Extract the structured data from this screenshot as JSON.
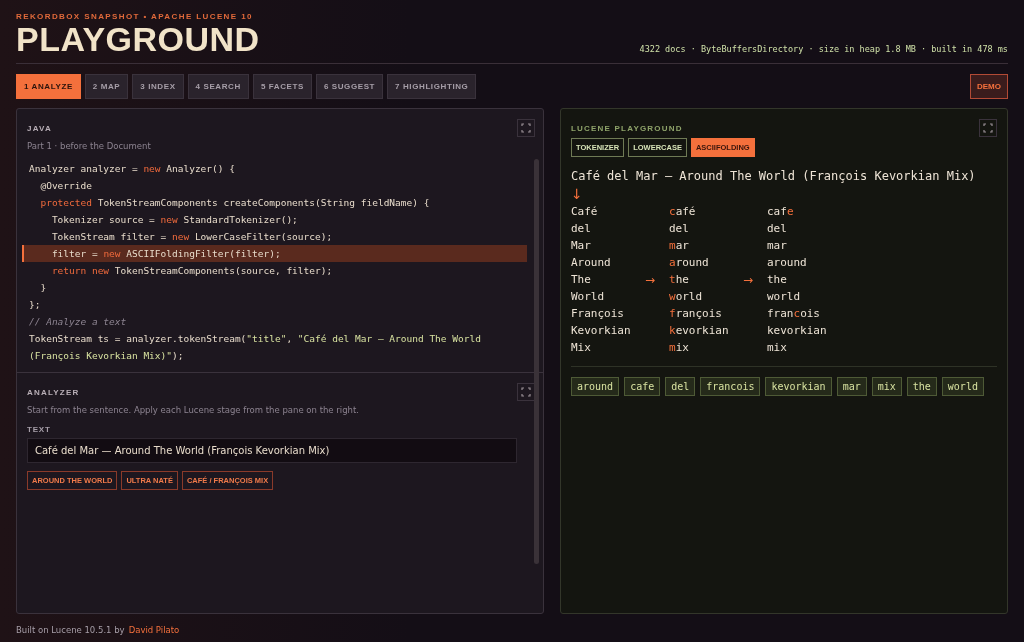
{
  "header": {
    "eyebrow": "REKORDBOX SNAPSHOT • APACHE LUCENE 10",
    "title": "PLAYGROUND",
    "stats": "4322 docs · ByteBuffersDirectory · size in heap 1.8 MB · built in 478 ms"
  },
  "tabs": [
    {
      "label": "1 ANALYZE",
      "selected": true
    },
    {
      "label": "2 MAP",
      "selected": false
    },
    {
      "label": "3 INDEX",
      "selected": false
    },
    {
      "label": "4 SEARCH",
      "selected": false
    },
    {
      "label": "5 FACETS",
      "selected": false
    },
    {
      "label": "6 SUGGEST",
      "selected": false
    },
    {
      "label": "7 HIGHLIGHTING",
      "selected": false
    }
  ],
  "demo_button": "DEMO",
  "java": {
    "title": "JAVA",
    "subtitle": "Part 1 · before the Document",
    "lines": [
      {
        "highlighted": false,
        "parts": [
          {
            "kind": "plain",
            "text": "Analyzer analyzer = "
          },
          {
            "kind": "keyword",
            "text": "new"
          },
          {
            "kind": "plain",
            "text": " Analyzer() {"
          }
        ]
      },
      {
        "highlighted": false,
        "parts": [
          {
            "kind": "plain",
            "text": "  @Override"
          }
        ]
      },
      {
        "highlighted": false,
        "parts": [
          {
            "kind": "keyword",
            "text": "  protected"
          },
          {
            "kind": "plain",
            "text": " TokenStreamComponents createComponents(String fieldName) {"
          }
        ]
      },
      {
        "highlighted": false,
        "parts": [
          {
            "kind": "plain",
            "text": "    Tokenizer source = "
          },
          {
            "kind": "keyword",
            "text": "new"
          },
          {
            "kind": "plain",
            "text": " StandardTokenizer();"
          }
        ]
      },
      {
        "highlighted": false,
        "parts": [
          {
            "kind": "plain",
            "text": "    TokenStream filter = "
          },
          {
            "kind": "keyword",
            "text": "new"
          },
          {
            "kind": "plain",
            "text": " LowerCaseFilter(source);"
          }
        ]
      },
      {
        "highlighted": true,
        "parts": [
          {
            "kind": "plain",
            "text": "    filter = "
          },
          {
            "kind": "keyword",
            "text": "new"
          },
          {
            "kind": "plain",
            "text": " ASCIIFoldingFilter(filter);"
          }
        ]
      },
      {
        "highlighted": false,
        "parts": [
          {
            "kind": "keyword",
            "text": "    return new"
          },
          {
            "kind": "plain",
            "text": " TokenStreamComponents(source, filter);"
          }
        ]
      },
      {
        "highlighted": false,
        "parts": [
          {
            "kind": "plain",
            "text": "  }"
          }
        ]
      },
      {
        "highlighted": false,
        "parts": [
          {
            "kind": "plain",
            "text": "};"
          }
        ]
      },
      {
        "highlighted": false,
        "parts": [
          {
            "kind": "comment",
            "text": "// Analyze a text"
          }
        ]
      },
      {
        "highlighted": false,
        "parts": [
          {
            "kind": "plain",
            "text": "TokenStream ts = analyzer.tokenStream("
          },
          {
            "kind": "string",
            "text": "\"title\""
          },
          {
            "kind": "plain",
            "text": ", "
          },
          {
            "kind": "string",
            "text": "\"Café del Mar — Around The World (François Kevorkian Mix)\""
          },
          {
            "kind": "plain",
            "text": ");"
          }
        ]
      }
    ]
  },
  "analyzer": {
    "title": "ANALYZER",
    "description": "Start from the sentence. Apply each Lucene stage from the pane on the right.",
    "field_label": "TEXT",
    "text_value": "Café del Mar — Around The World (François Kevorkian Mix)",
    "presets": [
      "AROUND THE WORLD",
      "ULTRA NATÉ",
      "CAFÉ / FRANÇOIS MIX"
    ]
  },
  "playground": {
    "title": "LUCENE PLAYGROUND",
    "stages": [
      {
        "label": "TOKENIZER",
        "selected": false
      },
      {
        "label": "LOWERCASE",
        "selected": false
      },
      {
        "label": "ASCIIFOLDING",
        "selected": true
      }
    ],
    "sentence": "Café del Mar — Around The World (François Kevorkian Mix)",
    "down_arrow": "↓",
    "columns": [
      {
        "tokens": [
          [
            {
              "text": "Café",
              "changed": false
            }
          ],
          [
            {
              "text": "del",
              "changed": false
            }
          ],
          [
            {
              "text": "Mar",
              "changed": false
            }
          ],
          [
            {
              "text": "Around",
              "changed": false
            }
          ],
          [
            {
              "text": "The",
              "changed": false
            }
          ],
          [
            {
              "text": "World",
              "changed": false
            }
          ],
          [
            {
              "text": "François",
              "changed": false
            }
          ],
          [
            {
              "text": "Kevorkian",
              "changed": false
            }
          ],
          [
            {
              "text": "Mix",
              "changed": false
            }
          ]
        ]
      },
      {
        "arrow": "→",
        "tokens": [
          [
            {
              "text": "c",
              "changed": true
            },
            {
              "text": "afé",
              "changed": false
            }
          ],
          [
            {
              "text": "del",
              "changed": false
            }
          ],
          [
            {
              "text": "m",
              "changed": true
            },
            {
              "text": "ar",
              "changed": false
            }
          ],
          [
            {
              "text": "a",
              "changed": true
            },
            {
              "text": "round",
              "changed": false
            }
          ],
          [
            {
              "text": "t",
              "changed": true
            },
            {
              "text": "he",
              "changed": false
            }
          ],
          [
            {
              "text": "w",
              "changed": true
            },
            {
              "text": "orld",
              "changed": false
            }
          ],
          [
            {
              "text": "f",
              "changed": true
            },
            {
              "text": "rançois",
              "changed": false
            }
          ],
          [
            {
              "text": "k",
              "changed": true
            },
            {
              "text": "evorkian",
              "changed": false
            }
          ],
          [
            {
              "text": "m",
              "changed": true
            },
            {
              "text": "ix",
              "changed": false
            }
          ]
        ]
      },
      {
        "arrow": "→",
        "tokens": [
          [
            {
              "text": "caf",
              "changed": false
            },
            {
              "text": "e",
              "changed": true
            }
          ],
          [
            {
              "text": "del",
              "changed": false
            }
          ],
          [
            {
              "text": "mar",
              "changed": false
            }
          ],
          [
            {
              "text": "around",
              "changed": false
            }
          ],
          [
            {
              "text": "the",
              "changed": false
            }
          ],
          [
            {
              "text": "world",
              "changed": false
            }
          ],
          [
            {
              "text": "fran",
              "changed": false
            },
            {
              "text": "c",
              "changed": true
            },
            {
              "text": "ois",
              "changed": false
            }
          ],
          [
            {
              "text": "kevorkian",
              "changed": false
            }
          ],
          [
            {
              "text": "mix",
              "changed": false
            }
          ]
        ]
      }
    ],
    "terms": [
      "around",
      "cafe",
      "del",
      "francois",
      "kevorkian",
      "mar",
      "mix",
      "the",
      "world"
    ]
  },
  "footer": {
    "text": "Built on Lucene 10.5.1 by",
    "link": "David Pilato"
  }
}
